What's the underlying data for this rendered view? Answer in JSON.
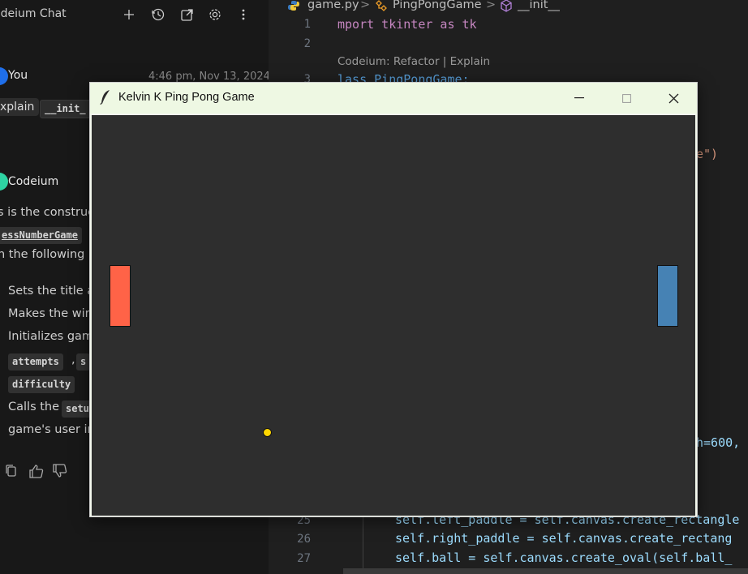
{
  "chat": {
    "title": "odeium Chat",
    "toolbar_icons": [
      "plus-icon",
      "history-icon",
      "open-external-icon",
      "gear-icon",
      "more-vertical-icon"
    ],
    "user": {
      "name": "You",
      "time": "4:46 pm, Nov 13, 2024",
      "chips": [
        "xplain",
        "__init_"
      ]
    },
    "assistant": {
      "name": "Codeium",
      "lines": [
        "s is the construc",
        "n the following"
      ],
      "code_refs": [
        "essNumberGame",
        "attempts",
        "s",
        "difficulty",
        "setu"
      ],
      "bullets": [
        "Sets the title a",
        "Makes the wir",
        "Initializes gam",
        "Calls the",
        "game's user ir"
      ],
      "separator": ","
    },
    "feedback_icons": [
      "copy-icon",
      "thumbs-up-icon",
      "thumbs-down-icon"
    ]
  },
  "editor": {
    "breadcrumb": {
      "file": "game.py",
      "class": "PingPongGame",
      "method": "__init__",
      "sep": ">"
    },
    "codelens": "Codeium: Refactor | Explain",
    "lines": [
      {
        "n": "1",
        "code": "mport tkinter as tk"
      },
      {
        "n": "2",
        "code": ""
      },
      {
        "n": "3",
        "code": "lass PingPongGame:"
      },
      {
        "n": "25",
        "code": "self.left_paddle = self.canvas.create_rectangle"
      },
      {
        "n": "26",
        "code": "self.right_paddle = self.canvas.create_rectang"
      },
      {
        "n": "27",
        "code": "self.ball = self.canvas.create_oval(self.ball_"
      }
    ],
    "fragments": {
      "frag1": "e\")",
      "frag2": "h=600,"
    }
  },
  "tk": {
    "title": "Kelvin K Ping Pong Game",
    "canvas_bg": "#2e2e2e",
    "left_paddle_color": "#ff6347",
    "right_paddle_color": "#4682b4",
    "ball_color": "#ffd700"
  }
}
